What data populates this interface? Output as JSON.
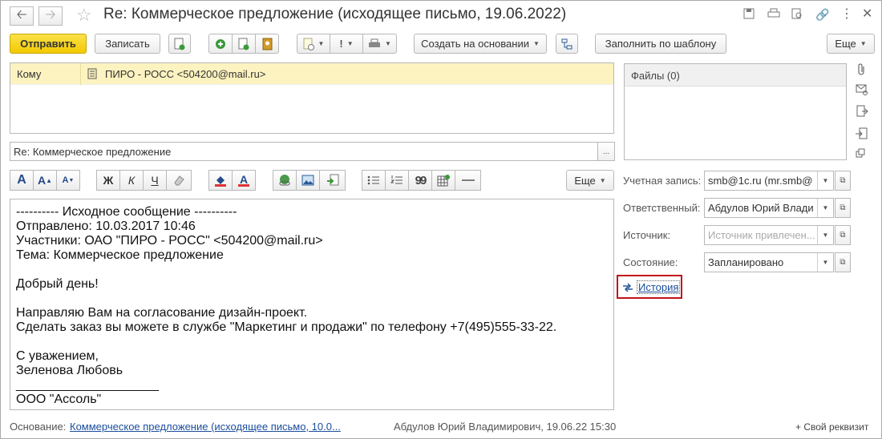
{
  "window": {
    "title": "Re: Коммерческое предложение (исходящее письмо, 19.06.2022)",
    "back_icon": "arrow-left-icon",
    "forward_icon": "arrow-right-icon",
    "star_icon": "star-icon",
    "more_icon": "more-icon",
    "close_icon": "close-icon"
  },
  "toolbar": {
    "send_label": "Отправить",
    "save_label": "Записать",
    "create_based_label": "Создать на основании",
    "fill_template_label": "Заполнить по шаблону",
    "more_label": "Еще",
    "excl_label": "!"
  },
  "recipients": {
    "to_label": "Кому",
    "to_value": "ПИРО - РОСС <504200@mail.ru>"
  },
  "subject": {
    "value": "Re: Коммерческое предложение",
    "button": "..."
  },
  "formatting": {
    "bold": "Ж",
    "italic": "К",
    "underline": "Ч",
    "font_a": "A",
    "quote": "99",
    "more_label": "Еще"
  },
  "message_lines": [
    "---------- Исходное сообщение ----------",
    "Отправлено: 10.03.2017 10:46",
    "Участники: ОАО \"ПИРО - РОСС\" <504200@mail.ru>",
    "Тема: Коммерческое предложение",
    "",
    "Добрый день!",
    "",
    "Направляю Вам на согласование дизайн-проект.",
    "Сделать заказ вы можете в службе \"Маркетинг и продажи\" по телефону +7(495)555-33-22.",
    "",
    "С уважением,",
    "Зеленова Любовь",
    "____________________",
    "ООО \"Ассоль\""
  ],
  "files": {
    "header": "Файлы (0)"
  },
  "properties": {
    "account_label": "Учетная запись:",
    "account_value": "smb@1c.ru (mr.smb@",
    "responsible_label": "Ответственный:",
    "responsible_value": "Абдулов Юрий Влади",
    "source_label": "Источник:",
    "source_placeholder": "Источник привлечен...",
    "state_label": "Состояние:",
    "state_value": "Запланировано",
    "history_link": "История"
  },
  "footer": {
    "basis_label": "Основание:",
    "basis_link": "Коммерческое предложение (исходящее письмо, 10.0...",
    "author_info": "Абдулов Юрий Владимирович, 19.06.22 15:30",
    "add_prop": "+ Свой реквизит"
  },
  "colors": {
    "primary_button": "#f2c901",
    "recipient_row": "#fdf3c0",
    "link": "#1a4d9c",
    "highlight_border": "#c0131a"
  }
}
